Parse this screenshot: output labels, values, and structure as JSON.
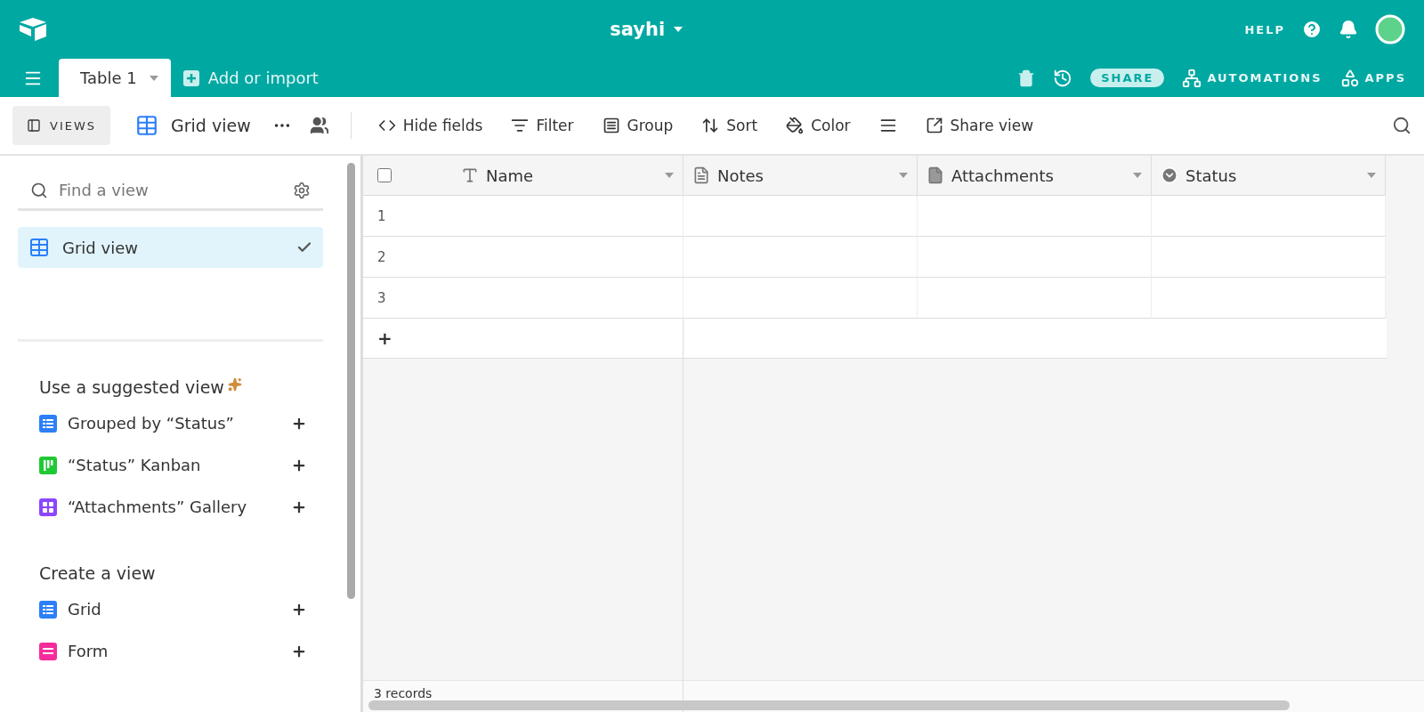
{
  "app": {
    "base_name": "sayhi",
    "help": "HELP"
  },
  "tabs": [
    {
      "label": "Table 1",
      "selected": true
    }
  ],
  "add_table": "Add or import",
  "header_actions": {
    "share": "SHARE",
    "automations": "AUTOMATIONS",
    "apps": "APPS"
  },
  "toolbar": {
    "views": "VIEWS",
    "view_name": "Grid view",
    "items": [
      {
        "kind": "hide",
        "label": "Hide fields"
      },
      {
        "kind": "filter",
        "label": "Filter"
      },
      {
        "kind": "group",
        "label": "Group"
      },
      {
        "kind": "sort",
        "label": "Sort"
      },
      {
        "kind": "color",
        "label": "Color"
      },
      {
        "kind": "height"
      },
      {
        "kind": "share",
        "label": "Share view"
      }
    ]
  },
  "sidebar": {
    "search": {
      "placeholder": "Find a view"
    },
    "views": [
      {
        "label": "Grid view",
        "selected": true
      }
    ],
    "suggested_title": "Use a suggested view",
    "suggested": [
      {
        "label": "Grouped by “Status”",
        "kind": "grid",
        "color": "#2d7ff9"
      },
      {
        "label": "“Status” Kanban",
        "kind": "kanban",
        "color": "#20c933"
      },
      {
        "label": "“Attachments” Gallery",
        "kind": "gallery",
        "color": "#8b46ff"
      }
    ],
    "create_title": "Create a view",
    "create": [
      {
        "label": "Grid",
        "kind": "grid",
        "color": "#2d7ff9"
      },
      {
        "label": "Form",
        "kind": "form",
        "color": "#f82b9b"
      }
    ]
  },
  "table": {
    "select_all": {
      "checked": false
    },
    "columns": [
      {
        "name": "Name",
        "kind": "text"
      },
      {
        "name": "Notes",
        "kind": "longtext"
      },
      {
        "name": "Attachments",
        "kind": "attachment"
      },
      {
        "name": "Status",
        "kind": "select"
      }
    ],
    "rows": [
      {
        "number": "1"
      },
      {
        "number": "2"
      },
      {
        "number": "3"
      }
    ],
    "add_row": "+",
    "footer": "3 records"
  }
}
